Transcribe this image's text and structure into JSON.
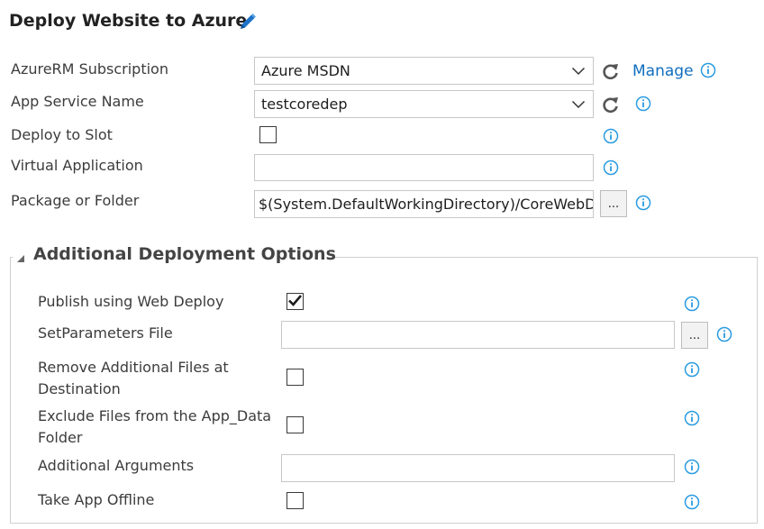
{
  "header": {
    "title": "Deploy Website to Azure"
  },
  "fields": {
    "azurerm_subscription": {
      "label": "AzureRM Subscription",
      "value": "Azure MSDN",
      "link": "Manage"
    },
    "app_service_name": {
      "label": "App Service Name",
      "value": "testcoredep"
    },
    "deploy_to_slot": {
      "label": "Deploy to Slot",
      "checked": false
    },
    "virtual_application": {
      "label": "Virtual Application",
      "value": ""
    },
    "package_or_folder": {
      "label": "Package or Folder",
      "value": "$(System.DefaultWorkingDirectory)/CoreWebD",
      "browse_label": "..."
    }
  },
  "additional": {
    "legend": "Additional Deployment Options",
    "publish_web_deploy": {
      "label": "Publish using Web Deploy",
      "checked": true
    },
    "setparameters_file": {
      "label": "SetParameters File",
      "value": "",
      "browse_label": "..."
    },
    "remove_additional_files": {
      "label": "Remove Additional Files at Destination",
      "checked": false
    },
    "exclude_app_data": {
      "label": "Exclude Files from the App_Data Folder",
      "checked": false
    },
    "additional_arguments": {
      "label": "Additional Arguments",
      "value": ""
    },
    "take_app_offline": {
      "label": "Take App Offline",
      "checked": false
    }
  },
  "icons": {
    "edit": "pencil-icon",
    "refresh": "refresh-icon",
    "info": "info-icon",
    "dropdown": "chevron-down-icon",
    "collapse": "collapse-triangle-icon",
    "check": "checkmark-icon"
  },
  "colors": {
    "link": "#106ebe",
    "info": "#2a9be0",
    "pencil": "#1e73c8"
  }
}
